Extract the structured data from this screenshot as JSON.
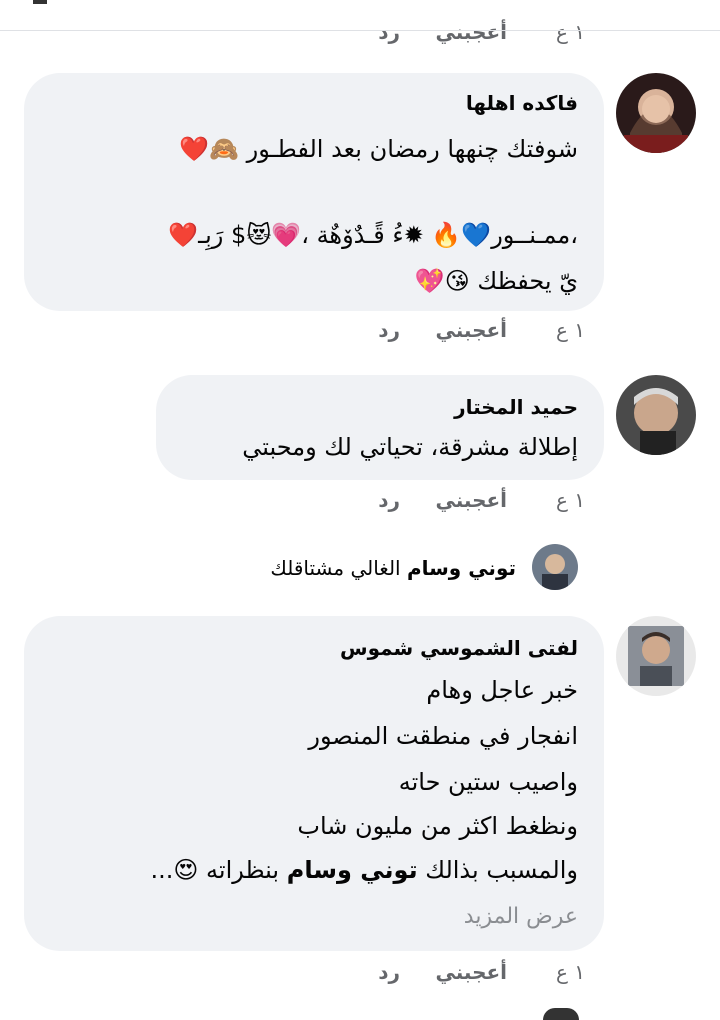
{
  "top_actions": {
    "time": "١ ع",
    "like": "أعجبني",
    "reply": "رد"
  },
  "comments": [
    {
      "author": "فاكده اهلها",
      "lines": [
        "شوفتك چنهها رمضان بعد الفطـور 🙈❤️",
        "،ممـنــور💙🔥 ✹ءُ قًـدٌۆهٌة ،💗😻$ رَبِـ❤️",
        "يّ يحفظك 😘💖"
      ],
      "time": "١ ع",
      "like": "أعجبني",
      "reply": "رد"
    },
    {
      "author": "حميد المختار",
      "lines": [
        "إطلالة مشرقة، تحياتي لك ومحبتي"
      ],
      "time": "١ ع",
      "like": "أعجبني",
      "reply": "رد"
    },
    {
      "author": "لفتى الشموسي شموس",
      "lines": [
        "خبر عاجل وهام",
        "انفجار في منطقت المنصور",
        "واصيب ستين حاته",
        "ونظغط اكثر من مليون شاب"
      ],
      "last_line_pre": "والمسبب بذالك",
      "last_line_mention": "توني وسام",
      "last_line_post": "بنظراته 😍...",
      "see_more": "عرض المزيد",
      "time": "١ ع",
      "like": "أعجبني",
      "reply": "رد"
    }
  ],
  "reply_preview": {
    "author": "توني وسام",
    "text": "الغالي مشتاقلك"
  }
}
